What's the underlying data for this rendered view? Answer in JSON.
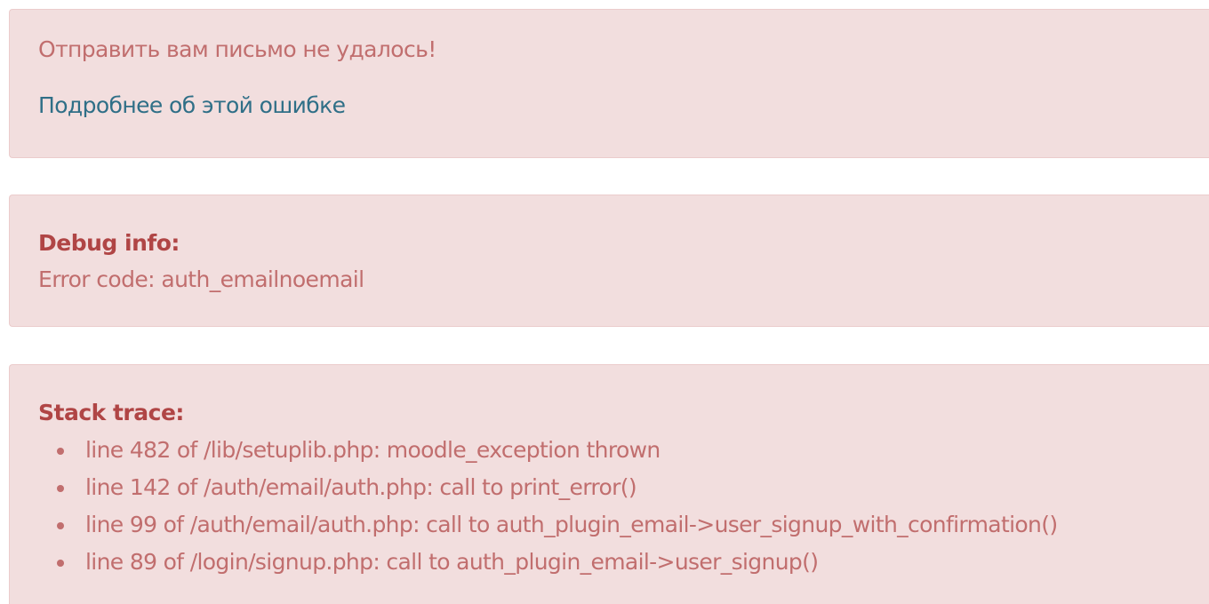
{
  "message_box": {
    "message": "Отправить вам письмо не удалось!",
    "details_link": "Подробнее об этой ошибке"
  },
  "debug_box": {
    "heading": "Debug info:",
    "error_code_line": "Error code: auth_emailnoemail"
  },
  "stack_box": {
    "heading": "Stack trace:",
    "items": [
      "line 482 of /lib/setuplib.php: moodle_exception thrown",
      "line 142 of /auth/email/auth.php: call to print_error()",
      "line 99 of /auth/email/auth.php: call to auth_plugin_email->user_signup_with_confirmation()",
      "line 89 of /login/signup.php: call to auth_plugin_email->user_signup()"
    ]
  },
  "colors": {
    "alert_background": "#f2dede",
    "alert_text": "#c16e6e",
    "heading_text": "#b04545",
    "link_text": "#2f6f87"
  }
}
